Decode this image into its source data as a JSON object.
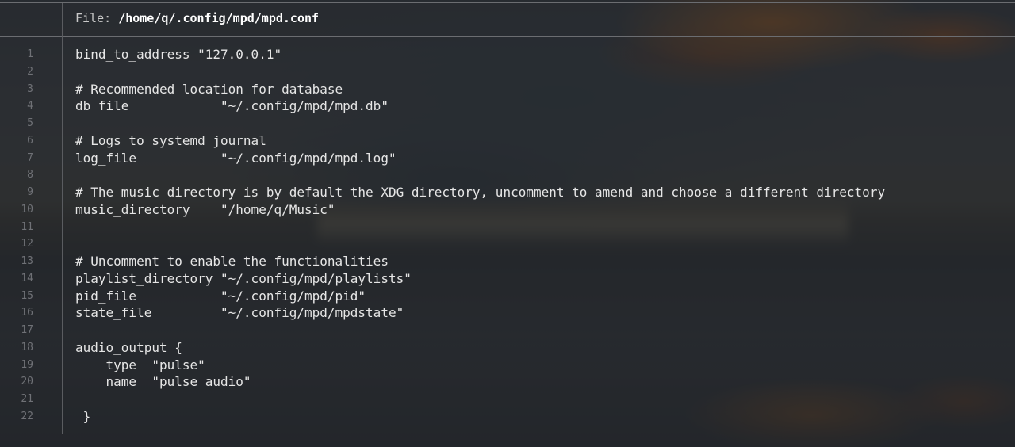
{
  "header": {
    "label": "File: ",
    "path": "/home/q/.config/mpd/mpd.conf"
  },
  "lines": [
    {
      "num": "1",
      "text": "bind_to_address \"127.0.0.1\""
    },
    {
      "num": "2",
      "text": ""
    },
    {
      "num": "3",
      "text": "# Recommended location for database"
    },
    {
      "num": "4",
      "text": "db_file            \"~/.config/mpd/mpd.db\""
    },
    {
      "num": "5",
      "text": ""
    },
    {
      "num": "6",
      "text": "# Logs to systemd journal"
    },
    {
      "num": "7",
      "text": "log_file           \"~/.config/mpd/mpd.log\""
    },
    {
      "num": "8",
      "text": ""
    },
    {
      "num": "9",
      "text": "# The music directory is by default the XDG directory, uncomment to amend and choose a different directory"
    },
    {
      "num": "10",
      "text": "music_directory    \"/home/q/Music\""
    },
    {
      "num": "11",
      "text": ""
    },
    {
      "num": "12",
      "text": ""
    },
    {
      "num": "13",
      "text": "# Uncomment to enable the functionalities"
    },
    {
      "num": "14",
      "text": "playlist_directory \"~/.config/mpd/playlists\""
    },
    {
      "num": "15",
      "text": "pid_file           \"~/.config/mpd/pid\""
    },
    {
      "num": "16",
      "text": "state_file         \"~/.config/mpd/mpdstate\""
    },
    {
      "num": "17",
      "text": ""
    },
    {
      "num": "18",
      "text": "audio_output {"
    },
    {
      "num": "19",
      "text": "    type  \"pulse\""
    },
    {
      "num": "20",
      "text": "    name  \"pulse audio\""
    },
    {
      "num": "21",
      "text": ""
    },
    {
      "num": "22",
      "text": " }"
    }
  ]
}
